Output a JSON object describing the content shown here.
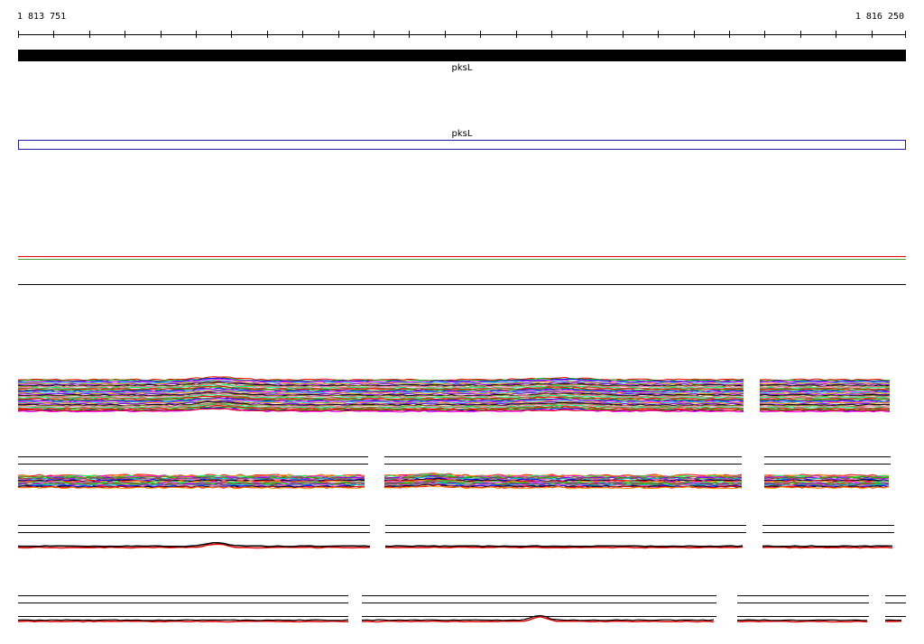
{
  "ruler": {
    "start_label": "1 813 751",
    "end_label": "1 816 250"
  },
  "genes": [
    {
      "label": "pksL"
    },
    {
      "label": "pksL"
    }
  ],
  "colors": {
    "gene_bar": "#000000",
    "gene_outline": "#1a1aa6",
    "line_red": "#e00000",
    "line_green": "#4a9a3a",
    "palette": [
      "#ff0000",
      "#00c000",
      "#0000ff",
      "#ff00ff",
      "#00c8c8",
      "#ff8c00",
      "#8000ff",
      "#000000",
      "#808000",
      "#ff69b4",
      "#00ff7f",
      "#a0522d"
    ]
  }
}
